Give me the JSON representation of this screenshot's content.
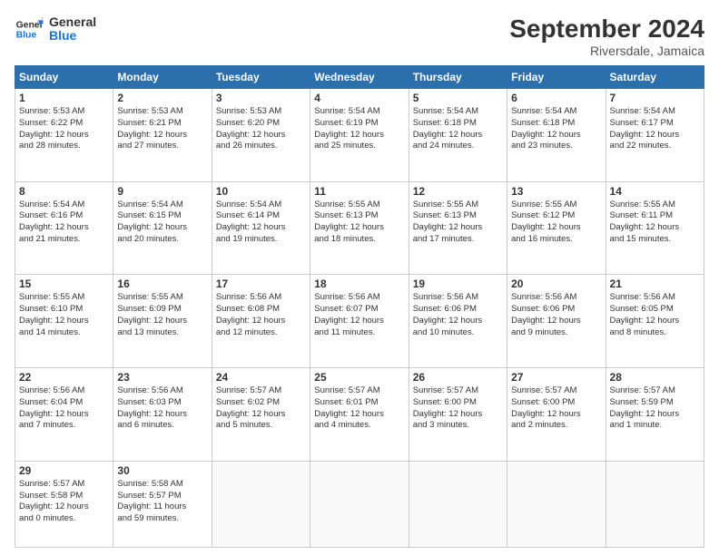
{
  "logo": {
    "line1": "General",
    "line2": "Blue"
  },
  "title": "September 2024",
  "subtitle": "Riversdale, Jamaica",
  "columns": [
    "Sunday",
    "Monday",
    "Tuesday",
    "Wednesday",
    "Thursday",
    "Friday",
    "Saturday"
  ],
  "weeks": [
    [
      {
        "day": "1",
        "info": "Sunrise: 5:53 AM\nSunset: 6:22 PM\nDaylight: 12 hours\nand 28 minutes."
      },
      {
        "day": "2",
        "info": "Sunrise: 5:53 AM\nSunset: 6:21 PM\nDaylight: 12 hours\nand 27 minutes."
      },
      {
        "day": "3",
        "info": "Sunrise: 5:53 AM\nSunset: 6:20 PM\nDaylight: 12 hours\nand 26 minutes."
      },
      {
        "day": "4",
        "info": "Sunrise: 5:54 AM\nSunset: 6:19 PM\nDaylight: 12 hours\nand 25 minutes."
      },
      {
        "day": "5",
        "info": "Sunrise: 5:54 AM\nSunset: 6:18 PM\nDaylight: 12 hours\nand 24 minutes."
      },
      {
        "day": "6",
        "info": "Sunrise: 5:54 AM\nSunset: 6:18 PM\nDaylight: 12 hours\nand 23 minutes."
      },
      {
        "day": "7",
        "info": "Sunrise: 5:54 AM\nSunset: 6:17 PM\nDaylight: 12 hours\nand 22 minutes."
      }
    ],
    [
      {
        "day": "8",
        "info": "Sunrise: 5:54 AM\nSunset: 6:16 PM\nDaylight: 12 hours\nand 21 minutes."
      },
      {
        "day": "9",
        "info": "Sunrise: 5:54 AM\nSunset: 6:15 PM\nDaylight: 12 hours\nand 20 minutes."
      },
      {
        "day": "10",
        "info": "Sunrise: 5:54 AM\nSunset: 6:14 PM\nDaylight: 12 hours\nand 19 minutes."
      },
      {
        "day": "11",
        "info": "Sunrise: 5:55 AM\nSunset: 6:13 PM\nDaylight: 12 hours\nand 18 minutes."
      },
      {
        "day": "12",
        "info": "Sunrise: 5:55 AM\nSunset: 6:13 PM\nDaylight: 12 hours\nand 17 minutes."
      },
      {
        "day": "13",
        "info": "Sunrise: 5:55 AM\nSunset: 6:12 PM\nDaylight: 12 hours\nand 16 minutes."
      },
      {
        "day": "14",
        "info": "Sunrise: 5:55 AM\nSunset: 6:11 PM\nDaylight: 12 hours\nand 15 minutes."
      }
    ],
    [
      {
        "day": "15",
        "info": "Sunrise: 5:55 AM\nSunset: 6:10 PM\nDaylight: 12 hours\nand 14 minutes."
      },
      {
        "day": "16",
        "info": "Sunrise: 5:55 AM\nSunset: 6:09 PM\nDaylight: 12 hours\nand 13 minutes."
      },
      {
        "day": "17",
        "info": "Sunrise: 5:56 AM\nSunset: 6:08 PM\nDaylight: 12 hours\nand 12 minutes."
      },
      {
        "day": "18",
        "info": "Sunrise: 5:56 AM\nSunset: 6:07 PM\nDaylight: 12 hours\nand 11 minutes."
      },
      {
        "day": "19",
        "info": "Sunrise: 5:56 AM\nSunset: 6:06 PM\nDaylight: 12 hours\nand 10 minutes."
      },
      {
        "day": "20",
        "info": "Sunrise: 5:56 AM\nSunset: 6:06 PM\nDaylight: 12 hours\nand 9 minutes."
      },
      {
        "day": "21",
        "info": "Sunrise: 5:56 AM\nSunset: 6:05 PM\nDaylight: 12 hours\nand 8 minutes."
      }
    ],
    [
      {
        "day": "22",
        "info": "Sunrise: 5:56 AM\nSunset: 6:04 PM\nDaylight: 12 hours\nand 7 minutes."
      },
      {
        "day": "23",
        "info": "Sunrise: 5:56 AM\nSunset: 6:03 PM\nDaylight: 12 hours\nand 6 minutes."
      },
      {
        "day": "24",
        "info": "Sunrise: 5:57 AM\nSunset: 6:02 PM\nDaylight: 12 hours\nand 5 minutes."
      },
      {
        "day": "25",
        "info": "Sunrise: 5:57 AM\nSunset: 6:01 PM\nDaylight: 12 hours\nand 4 minutes."
      },
      {
        "day": "26",
        "info": "Sunrise: 5:57 AM\nSunset: 6:00 PM\nDaylight: 12 hours\nand 3 minutes."
      },
      {
        "day": "27",
        "info": "Sunrise: 5:57 AM\nSunset: 6:00 PM\nDaylight: 12 hours\nand 2 minutes."
      },
      {
        "day": "28",
        "info": "Sunrise: 5:57 AM\nSunset: 5:59 PM\nDaylight: 12 hours\nand 1 minute."
      }
    ],
    [
      {
        "day": "29",
        "info": "Sunrise: 5:57 AM\nSunset: 5:58 PM\nDaylight: 12 hours\nand 0 minutes."
      },
      {
        "day": "30",
        "info": "Sunrise: 5:58 AM\nSunset: 5:57 PM\nDaylight: 11 hours\nand 59 minutes."
      },
      {
        "day": "",
        "info": ""
      },
      {
        "day": "",
        "info": ""
      },
      {
        "day": "",
        "info": ""
      },
      {
        "day": "",
        "info": ""
      },
      {
        "day": "",
        "info": ""
      }
    ]
  ]
}
